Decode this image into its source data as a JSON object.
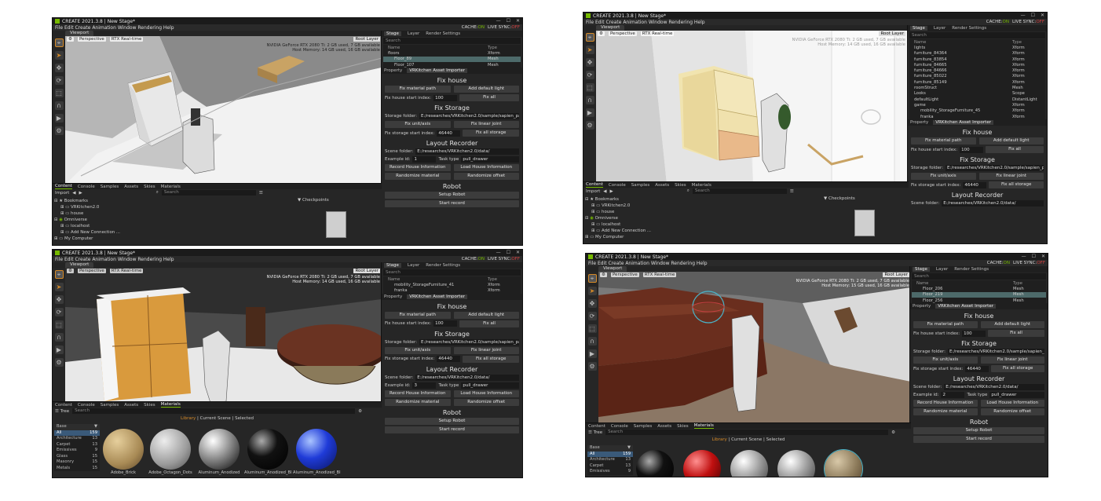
{
  "app": {
    "title": "CREATE  2021.3.8 | New Stage*",
    "menu": "File  Edit  Create  Animation  Window  Rendering  Help",
    "cache_label": "CACHE:",
    "cache_state": "ON",
    "live_sync_label": "LIVE SYNC:",
    "live_sync_state": "OFF",
    "viewport_tab": "Viewport",
    "perspective": "Perspective",
    "rtx": "RTX Real-time",
    "root_layer": "Root Layer",
    "gpu_line1": "NVIDIA GeForce RTX 2080 Ti: 2 GB used, 7 GB available",
    "gpu_line1_b": "NVIDIA GeForce RTX 2080 Ti: 2 GB used, 7 GB available",
    "host_mem_a": "Host Memory: 14 GB used, 16 GB available",
    "host_mem_b": "Host Memory: 15 GB used, 16 GB available"
  },
  "stage": {
    "tabs": [
      "Stage",
      "Layer",
      "Render Settings"
    ],
    "search_placeholder": "Search",
    "col_name": "Name",
    "col_type": "Type",
    "p1_rows": [
      {
        "name": "floors",
        "type": "Xform"
      },
      {
        "name": "Floor_89",
        "type": "Mesh"
      },
      {
        "name": "Floor_107",
        "type": "Mesh"
      }
    ],
    "p2_rows": [
      {
        "name": "lights",
        "type": "Xform"
      },
      {
        "name": "furniture_84364",
        "type": "Xform"
      },
      {
        "name": "furniture_83854",
        "type": "Xform"
      },
      {
        "name": "furniture_84665",
        "type": "Xform"
      },
      {
        "name": "furniture_84666",
        "type": "Xform"
      },
      {
        "name": "furniture_85022",
        "type": "Xform"
      },
      {
        "name": "furniture_85149",
        "type": "Xform"
      },
      {
        "name": "roomStruct",
        "type": "Mesh"
      },
      {
        "name": "Looks",
        "type": "Scope"
      },
      {
        "name": "defaultLight",
        "type": "DistantLight"
      },
      {
        "name": "game",
        "type": "Xform"
      },
      {
        "name": "mobility_StorageFurniture_45",
        "type": "Xform"
      },
      {
        "name": "franka",
        "type": "Xform"
      }
    ],
    "p3_rows": [
      {
        "name": "mobility_StorageFurniture_41",
        "type": "Xform"
      },
      {
        "name": "franka",
        "type": "Xform"
      }
    ],
    "p4_rows": [
      {
        "name": "Floor_206",
        "type": "Mesh"
      },
      {
        "name": "Floor_219",
        "type": "Mesh"
      },
      {
        "name": "Floor_256",
        "type": "Mesh"
      }
    ]
  },
  "props": {
    "tabs": [
      "Property",
      "VRKitchen Asset Importer"
    ],
    "fix_house": "Fix house",
    "fix_material_path": "Fix material path",
    "add_default_light": "Add default light",
    "fix_house_start_label": "Fix house start index:",
    "fix_house_start_value": "100",
    "fix_all": "Fix all",
    "fix_storage": "Fix Storage",
    "storage_folder_label": "Storage folder:",
    "storage_folder_value": "E:/researches/VRKitchen2.0/sample/sapien_parsed/S",
    "fix_unit_axis": "Fix unit/axis",
    "fix_linear_joint": "Fix linear joint",
    "fix_storage_start_label": "Fix storage start index:",
    "fix_storage_start_value": "46440",
    "fix_all_storage": "Fix all storage",
    "layout_recorder": "Layout Recorder",
    "scene_folder_label": "Scene folder:",
    "scene_folder_value": "E:/researches/VRKitchen2.0/data/",
    "example_id_label": "Example id:",
    "example_id_1": "1",
    "example_id_3": "3",
    "example_id_2": "2",
    "task_type_label": "Task type",
    "task_type_value": "pull_drawer",
    "record_house": "Record House Information",
    "load_house": "Load House Information",
    "randomize_material": "Randomize material",
    "randomize_offset": "Randomize offset",
    "robot": "Robot",
    "setup_robot": "Setup Robot",
    "start_record": "Start record"
  },
  "content": {
    "tabs": [
      "Content",
      "Console",
      "Samples",
      "Assets",
      "Skies",
      "Materials"
    ],
    "import": "Import",
    "search_placeholder": "Search",
    "tree": [
      "Bookmarks",
      "VRKitchen2.0",
      "house",
      "Omniverse",
      "localhost",
      "Add New Connection ...",
      "My Computer"
    ],
    "checkpoints": "Checkpoints",
    "tree_btn": "Tree",
    "library": "Library",
    "current_scene": "Current Scene",
    "selected": "Selected",
    "base": "Base",
    "categories": [
      {
        "name": "All",
        "count": "159"
      },
      {
        "name": "Architecture",
        "count": "13"
      },
      {
        "name": "Carpet",
        "count": "13"
      },
      {
        "name": "Emissives",
        "count": "9"
      },
      {
        "name": "Glass",
        "count": "15"
      },
      {
        "name": "Masonry",
        "count": "15"
      },
      {
        "name": "Metals",
        "count": "15"
      }
    ],
    "materials": [
      "Adobe_Brick",
      "Adobe_Octagon_Dots",
      "Aluminum_Anodized",
      "Aluminum_Anodized_Bl",
      "Aluminum_Anodized_Bl"
    ]
  },
  "colors": {
    "nvidia_green": "#76b900",
    "accent_orange": "#d68a27",
    "selected_row": "#4d6a6a"
  }
}
